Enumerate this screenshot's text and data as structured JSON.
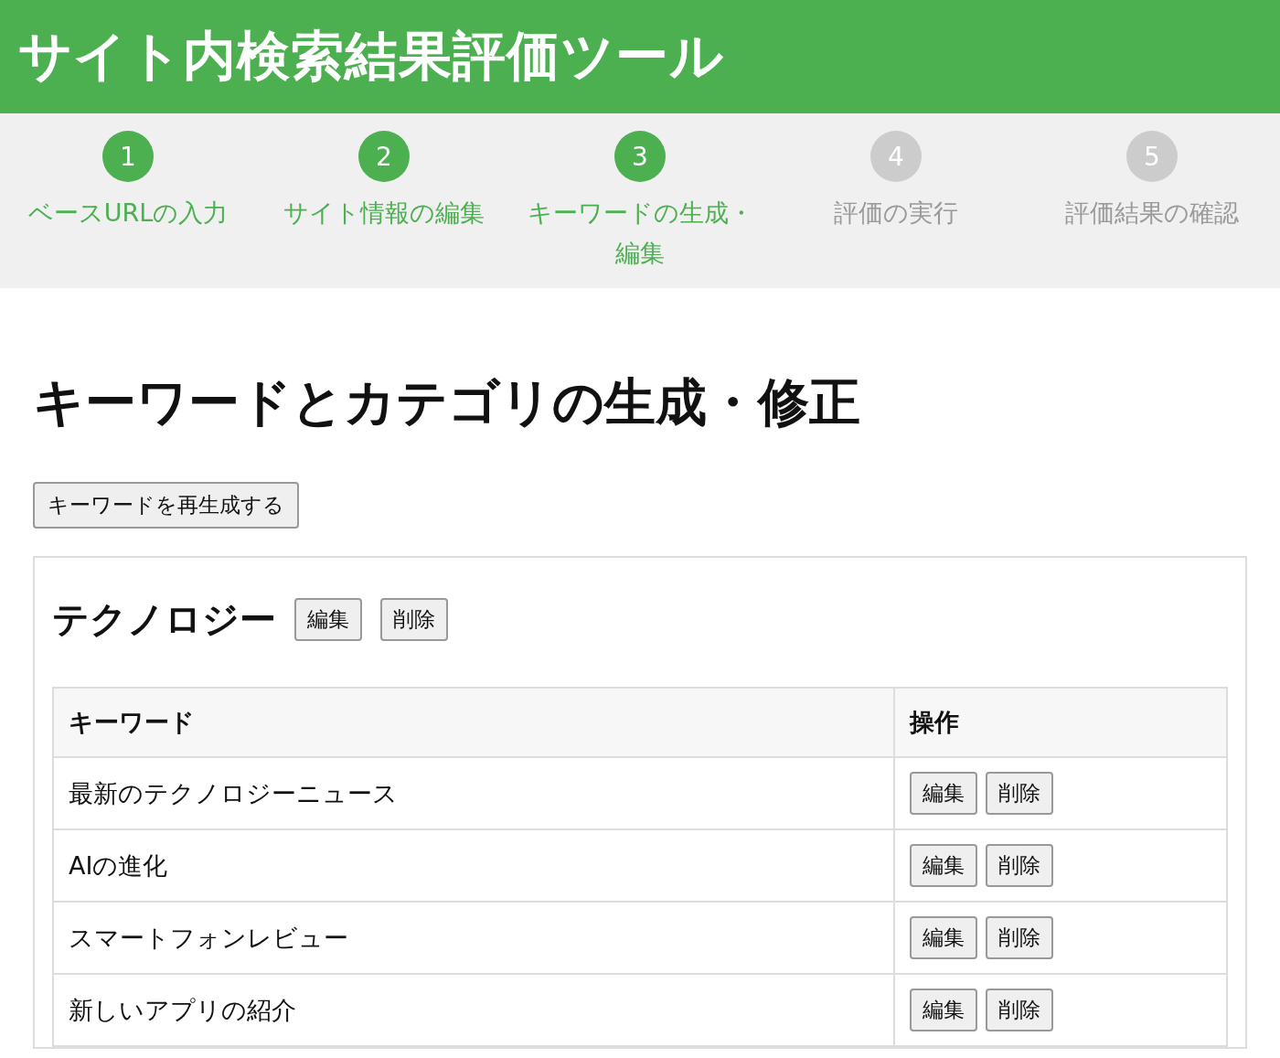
{
  "app_title": "サイト内検索結果評価ツール",
  "steps": [
    {
      "number": "1",
      "label": "ベースURLの入力",
      "reached": true
    },
    {
      "number": "2",
      "label": "サイト情報の編集",
      "reached": true
    },
    {
      "number": "3",
      "label": "キーワードの生成・編集",
      "reached": true
    },
    {
      "number": "4",
      "label": "評価の実行",
      "reached": false
    },
    {
      "number": "5",
      "label": "評価結果の確認",
      "reached": false
    }
  ],
  "page_title": "キーワードとカテゴリの生成・修正",
  "regenerate_button": "キーワードを再生成する",
  "categories": [
    {
      "name": "テクノロジー",
      "edit_button": "編集",
      "delete_button": "削除",
      "table": {
        "columns": [
          "キーワード",
          "操作"
        ],
        "rows": [
          {
            "keyword": "最新のテクノロジーニュース",
            "edit_button": "編集",
            "delete_button": "削除"
          },
          {
            "keyword": "AIの進化",
            "edit_button": "編集",
            "delete_button": "削除"
          },
          {
            "keyword": "スマートフォンレビュー",
            "edit_button": "編集",
            "delete_button": "削除"
          },
          {
            "keyword": "新しいアプリの紹介",
            "edit_button": "編集",
            "delete_button": "削除"
          }
        ]
      }
    }
  ]
}
